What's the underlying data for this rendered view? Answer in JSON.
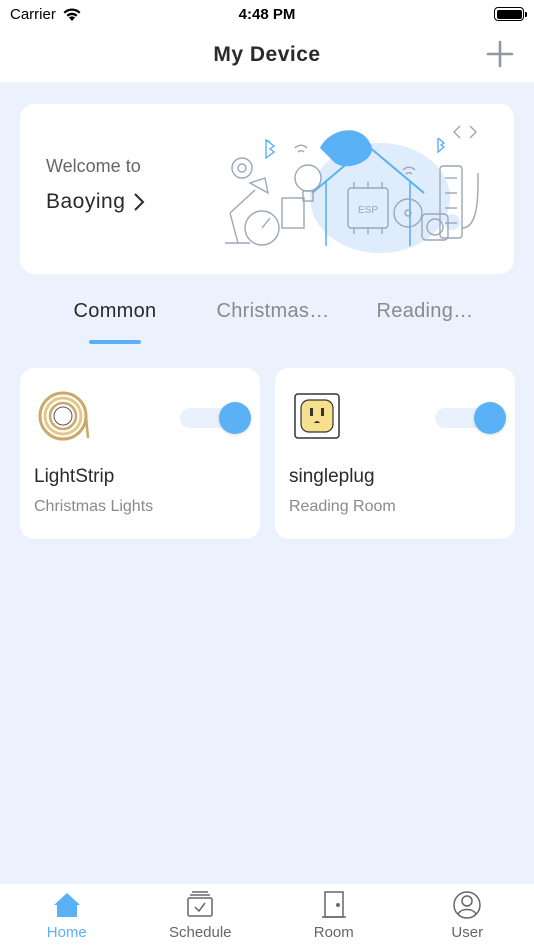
{
  "status_bar": {
    "carrier": "Carrier",
    "time": "4:48 PM",
    "battery_level": 1.0
  },
  "header": {
    "title": "My Device",
    "add_icon": "plus-icon"
  },
  "welcome": {
    "label": "Welcome to",
    "name": "Baoying"
  },
  "tabs": [
    {
      "label": "Common",
      "active": true
    },
    {
      "label": "Christmas…",
      "active": false
    },
    {
      "label": "Reading…",
      "active": false
    }
  ],
  "devices": [
    {
      "name": "LightStrip",
      "room": "Christmas Lights",
      "on": true,
      "icon": "light-strip-icon"
    },
    {
      "name": "singleplug",
      "room": "Reading Room",
      "on": true,
      "icon": "plug-socket-icon"
    }
  ],
  "nav": [
    {
      "label": "Home",
      "icon": "home-icon",
      "active": true
    },
    {
      "label": "Schedule",
      "icon": "schedule-icon",
      "active": false
    },
    {
      "label": "Room",
      "icon": "door-icon",
      "active": false
    },
    {
      "label": "User",
      "icon": "user-icon",
      "active": false
    }
  ],
  "colors": {
    "accent": "#5ab1f5",
    "background": "#ebf2fd",
    "card": "#ffffff"
  }
}
